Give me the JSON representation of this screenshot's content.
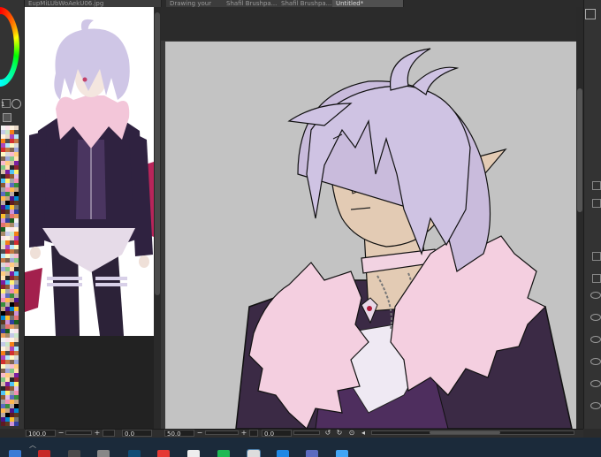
{
  "tabs": [
    {
      "label": "EupMiLUbWoAekU06.jpg",
      "active": false
    },
    {
      "label": "Drawing your",
      "active": false
    },
    {
      "label": "Shafil Brushpa...",
      "active": false
    },
    {
      "label": "Shafil Brushpa...",
      "active": false
    },
    {
      "label": "Untitled*",
      "active": true
    }
  ],
  "left_panel": {
    "value_label": "1"
  },
  "ref_status": {
    "zoom": "100.0",
    "angle": "0.0"
  },
  "main_status": {
    "zoom": "50.0",
    "angle": "0.0"
  },
  "colors": {
    "canvas_bg": "#c3c3c3",
    "hair": "#cfc3e3",
    "skin": "#e3cbb4",
    "fur": "#f4cfe0",
    "jacket": "#3b2a45"
  },
  "taskbar": {
    "icons": [
      "start-icon",
      "browser-icon",
      "chrome-icon",
      "store-icon",
      "terminal-icon",
      "folder-icon",
      "app-icon",
      "spotify-icon",
      "clip-studio-icon",
      "photo-icon",
      "mail-icon",
      "paint-icon"
    ]
  }
}
